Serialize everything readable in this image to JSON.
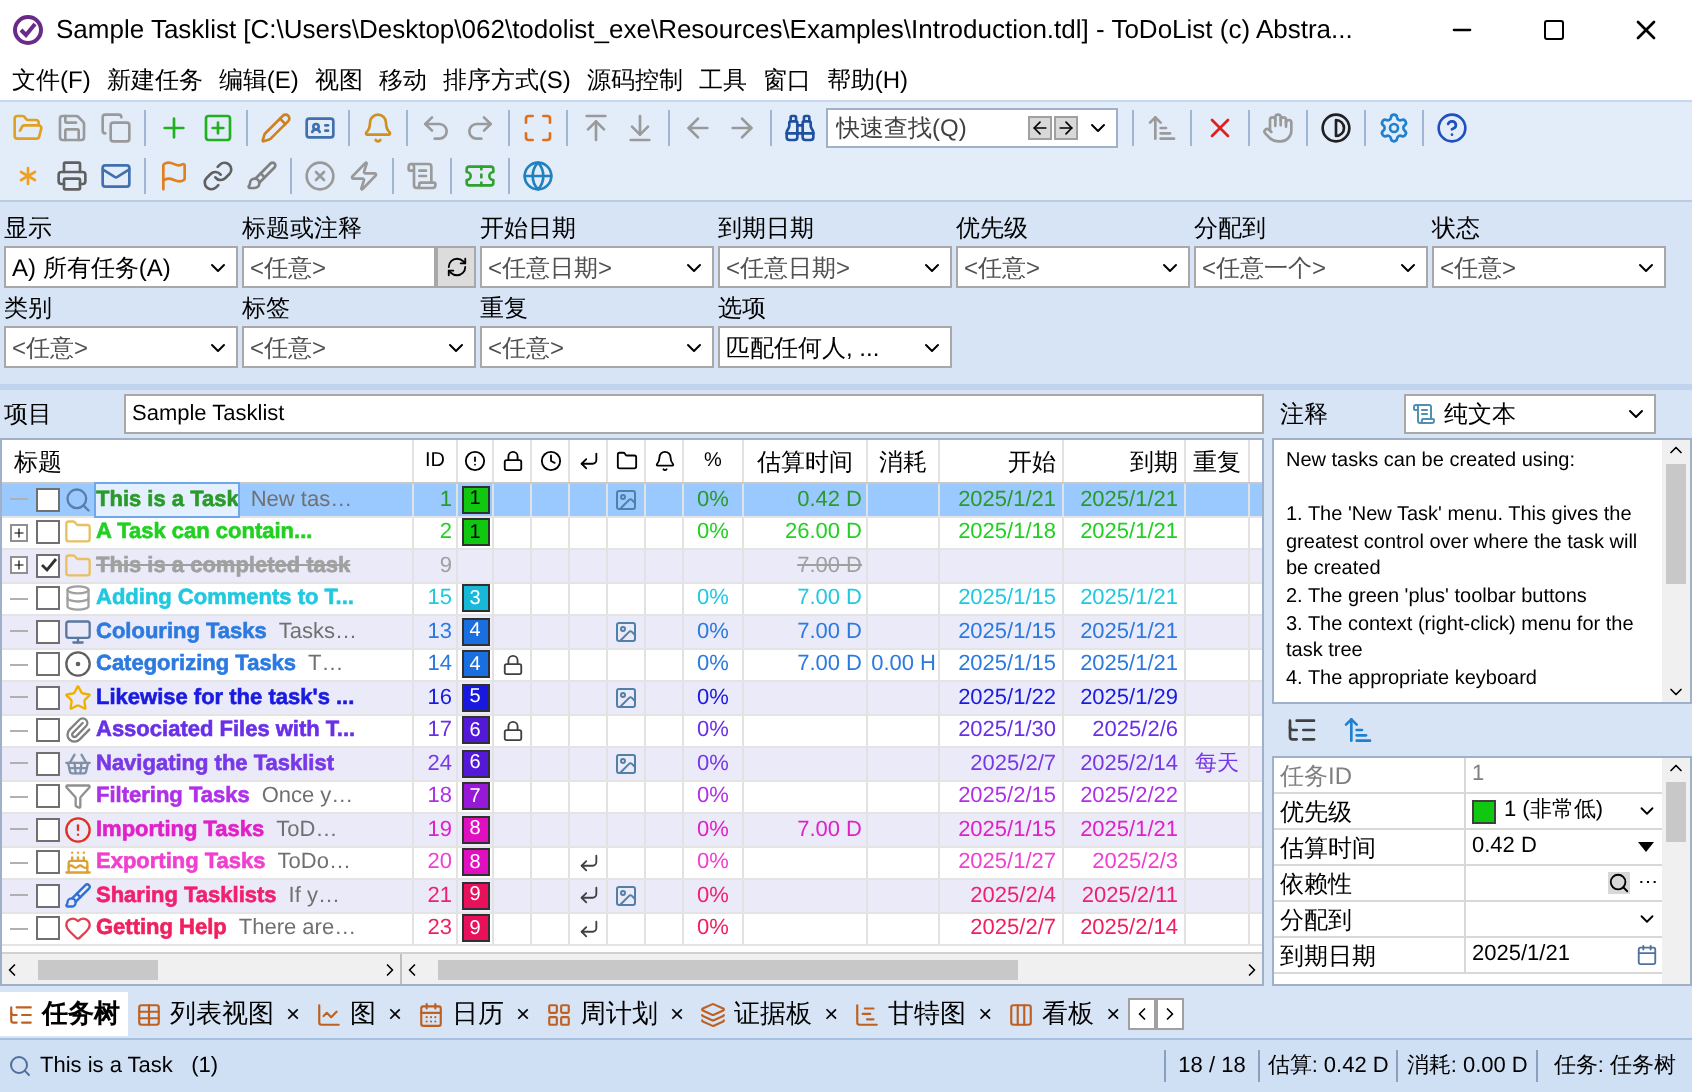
{
  "window": {
    "title": "Sample Tasklist [C:\\Users\\Desktop\\062\\todolist_exe\\Resources\\Examples\\Introduction.tdl] - ToDoList (c) Abstra..."
  },
  "menu": [
    "文件(F)",
    "新建任务",
    "编辑(E)",
    "视图",
    "移动",
    "排序方式(S)",
    "源码控制",
    "工具",
    "窗口",
    "帮助(H)"
  ],
  "quick_find": {
    "placeholder": "快速查找(Q)"
  },
  "filters": [
    {
      "label": "显示",
      "value": "A)  所有任务(A)",
      "kind": "combo"
    },
    {
      "label": "标题或注释",
      "value": "<任意>",
      "kind": "text"
    },
    {
      "label": "开始日期",
      "value": "<任意日期>",
      "kind": "combo"
    },
    {
      "label": "到期日期",
      "value": "<任意日期>",
      "kind": "combo"
    },
    {
      "label": "优先级",
      "value": "<任意>",
      "kind": "combo"
    },
    {
      "label": "分配到",
      "value": "<任意一个>",
      "kind": "combo"
    },
    {
      "label": "状态",
      "value": "<任意>",
      "kind": "combo"
    },
    {
      "label": "类别",
      "value": "<任意>",
      "kind": "combo"
    },
    {
      "label": "标签",
      "value": "<任意>",
      "kind": "combo"
    },
    {
      "label": "重复",
      "value": "<任意>",
      "kind": "combo"
    },
    {
      "label": "选项",
      "value": "匹配任何人, ...",
      "kind": "combo"
    }
  ],
  "project": {
    "label": "项目",
    "value": "Sample Tasklist"
  },
  "columns": {
    "title": "标题",
    "id": "ID",
    "percent": "%",
    "estimate": "估算时间",
    "spent": "消耗",
    "start": "开始",
    "due": "到期",
    "recur": "重复"
  },
  "tasks": [
    {
      "title": "This is a Task",
      "comment": "New tas…",
      "id": "1",
      "priority": {
        "label": "1",
        "color": "#10c810"
      },
      "color": "#2a9a2a",
      "locked": false,
      "dependency": false,
      "file": true,
      "percent": "0%",
      "estimate": "0.42 D",
      "start": "2025/1/21",
      "due": "2025/1/21",
      "done": false,
      "expandable": false,
      "selected": true
    },
    {
      "title": "A Task can contain...",
      "id": "2",
      "priority": {
        "label": "1",
        "color": "#10c810"
      },
      "color": "#22d022",
      "locked": false,
      "dependency": false,
      "file": false,
      "percent": "0%",
      "estimate": "26.00 D",
      "start": "2025/1/18",
      "due": "2025/1/21",
      "done": false,
      "expandable": true,
      "selected": false
    },
    {
      "title": "This is a completed task",
      "id": "9",
      "color": "#a0a0a0",
      "locked": false,
      "dependency": false,
      "file": false,
      "estimate": "7.00 D",
      "done": true,
      "expandable": true,
      "selected": false
    },
    {
      "title": "Adding Comments to T...",
      "id": "15",
      "priority": {
        "label": "3",
        "color": "#18b8d8"
      },
      "color": "#20c8e0",
      "locked": false,
      "dependency": false,
      "file": false,
      "percent": "0%",
      "estimate": "7.00 D",
      "start": "2025/1/15",
      "due": "2025/1/21",
      "done": false,
      "expandable": false,
      "selected": false
    },
    {
      "title": "Colouring Tasks",
      "comment": "Tasks…",
      "id": "13",
      "priority": {
        "label": "4",
        "color": "#1a6fe0"
      },
      "color": "#2c7ae0",
      "locked": false,
      "dependency": false,
      "file": true,
      "percent": "0%",
      "estimate": "7.00 D",
      "start": "2025/1/15",
      "due": "2025/1/21",
      "done": false,
      "expandable": false,
      "selected": false
    },
    {
      "title": "Categorizing Tasks",
      "comment": "T…",
      "id": "14",
      "priority": {
        "label": "4",
        "color": "#1a6fe0"
      },
      "color": "#2c7ae0",
      "locked": true,
      "dependency": false,
      "file": false,
      "percent": "0%",
      "estimate": "7.00 D",
      "spent": "0.00 H",
      "start": "2025/1/15",
      "due": "2025/1/21",
      "done": false,
      "expandable": false,
      "selected": false
    },
    {
      "title": "Likewise for the task's ...",
      "id": "16",
      "priority": {
        "label": "5",
        "color": "#1818e0"
      },
      "color": "#1a1ae0",
      "locked": false,
      "dependency": false,
      "file": true,
      "percent": "0%",
      "start": "2025/1/22",
      "due": "2025/1/29",
      "done": false,
      "expandable": false,
      "selected": false
    },
    {
      "title": "Associated Files with T...",
      "id": "17",
      "priority": {
        "label": "6",
        "color": "#5418d8"
      },
      "color": "#6a30e8",
      "locked": true,
      "dependency": false,
      "file": false,
      "percent": "0%",
      "start": "2025/1/30",
      "due": "2025/2/6",
      "done": false,
      "expandable": false,
      "selected": false
    },
    {
      "title": "Navigating the Tasklist",
      "id": "24",
      "priority": {
        "label": "6",
        "color": "#5418d8"
      },
      "color": "#7838e8",
      "locked": false,
      "dependency": false,
      "file": true,
      "percent": "0%",
      "start": "2025/2/7",
      "due": "2025/2/14",
      "recur": "每天",
      "done": false,
      "expandable": false,
      "selected": false
    },
    {
      "title": "Filtering Tasks",
      "comment": "Once y…",
      "id": "18",
      "priority": {
        "label": "7",
        "color": "#9818d8"
      },
      "color": "#b030e8",
      "locked": false,
      "dependency": false,
      "file": false,
      "percent": "0%",
      "start": "2025/2/15",
      "due": "2025/2/22",
      "done": false,
      "expandable": false,
      "selected": false
    },
    {
      "title": "Importing Tasks",
      "comment": "ToD…",
      "id": "19",
      "priority": {
        "label": "8",
        "color": "#e010c0"
      },
      "color": "#e020c8",
      "locked": false,
      "dependency": false,
      "file": false,
      "percent": "0%",
      "estimate": "7.00 D",
      "start": "2025/1/15",
      "due": "2025/1/21",
      "done": false,
      "expandable": false,
      "selected": false
    },
    {
      "title": "Exporting Tasks",
      "comment": "ToDo…",
      "id": "20",
      "priority": {
        "label": "8",
        "color": "#e010c0"
      },
      "color": "#f040d0",
      "locked": false,
      "dependency": true,
      "file": false,
      "percent": "0%",
      "start": "2025/1/27",
      "due": "2025/2/3",
      "done": false,
      "expandable": false,
      "selected": false
    },
    {
      "title": "Sharing Tasklists",
      "comment": "If y…",
      "id": "21",
      "priority": {
        "label": "9",
        "color": "#e8105a"
      },
      "color": "#f02070",
      "locked": false,
      "dependency": true,
      "file": true,
      "percent": "0%",
      "start": "2025/2/4",
      "due": "2025/2/11",
      "done": false,
      "expandable": false,
      "selected": false
    },
    {
      "title": "Getting Help",
      "comment": "There are…",
      "id": "23",
      "priority": {
        "label": "9",
        "color": "#e8105a"
      },
      "color": "#f02060",
      "locked": false,
      "dependency": true,
      "file": false,
      "percent": "0%",
      "start": "2025/2/7",
      "due": "2025/2/14",
      "done": false,
      "expandable": false,
      "selected": false
    }
  ],
  "comments": {
    "label": "注释",
    "format": "纯文本",
    "lines": [
      "New tasks can be created using:",
      "1. The 'New Task' menu. This gives the greatest control over where the task will be created",
      "2. The green 'plus' toolbar buttons",
      "3. The context (right-click) menu for the task tree",
      "4. The appropriate keyboard"
    ]
  },
  "properties": [
    {
      "label": "任务ID",
      "value": "1",
      "kind": "readonly"
    },
    {
      "label": "优先级",
      "value": "1 (非常低)",
      "kind": "priority",
      "color": "#10c810"
    },
    {
      "label": "估算时间",
      "value": "0.42 D",
      "kind": "spin"
    },
    {
      "label": "依赖性",
      "kind": "search",
      "button": "⋯"
    },
    {
      "label": "分配到",
      "kind": "combo"
    },
    {
      "label": "到期日期",
      "value": "2025/1/21",
      "kind": "date"
    }
  ],
  "view_tabs": [
    {
      "label": "任务树",
      "selected": true,
      "closable": false
    },
    {
      "label": "列表视图",
      "selected": false,
      "closable": true
    },
    {
      "label": "图",
      "selected": false,
      "closable": true
    },
    {
      "label": "日历",
      "selected": false,
      "closable": true
    },
    {
      "label": "周计划",
      "selected": false,
      "closable": true
    },
    {
      "label": "证据板",
      "selected": false,
      "closable": true
    },
    {
      "label": "甘特图",
      "selected": false,
      "closable": true
    },
    {
      "label": "看板",
      "selected": false,
      "closable": true
    }
  ],
  "tab_close": "×",
  "status_bar": {
    "task": "This is a Task   (1)",
    "count": "18 / 18",
    "estimate": "估算: 0.42 D",
    "spent": "消耗: 0.00 D",
    "view": "任务: 任务树"
  }
}
